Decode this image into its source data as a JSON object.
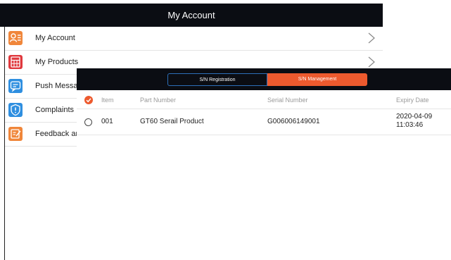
{
  "header": {
    "title": "My Account"
  },
  "menu": {
    "items": [
      {
        "label": "My Account",
        "icon": "user-list-icon",
        "color": "#f0863a"
      },
      {
        "label": "My Products",
        "icon": "calculator-icon",
        "color": "#e0393e"
      },
      {
        "label": "Push Messag",
        "icon": "message-icon",
        "color": "#2f8fe0"
      },
      {
        "label": "Complaints",
        "icon": "alert-shield-icon",
        "color": "#2f8fe0"
      },
      {
        "label": "Feedback an",
        "icon": "edit-note-icon",
        "color": "#f0863a"
      }
    ]
  },
  "sn_panel": {
    "tabs": [
      {
        "label": "S/N Registration",
        "active": false
      },
      {
        "label": "S/N Management",
        "active": true
      }
    ],
    "columns": [
      "Item",
      "Part Number",
      "Serial Number",
      "Expiry Date"
    ],
    "rows": [
      {
        "item": "001",
        "part_number": "GT60 Serail Product",
        "serial_number": "G006006149001",
        "expiry_date": "2020-04-09",
        "expiry_time": "11:03:46"
      }
    ]
  },
  "colors": {
    "accent": "#ed5a2e",
    "header_bg": "#0b0d13",
    "tab_border": "#2d6fb8"
  }
}
